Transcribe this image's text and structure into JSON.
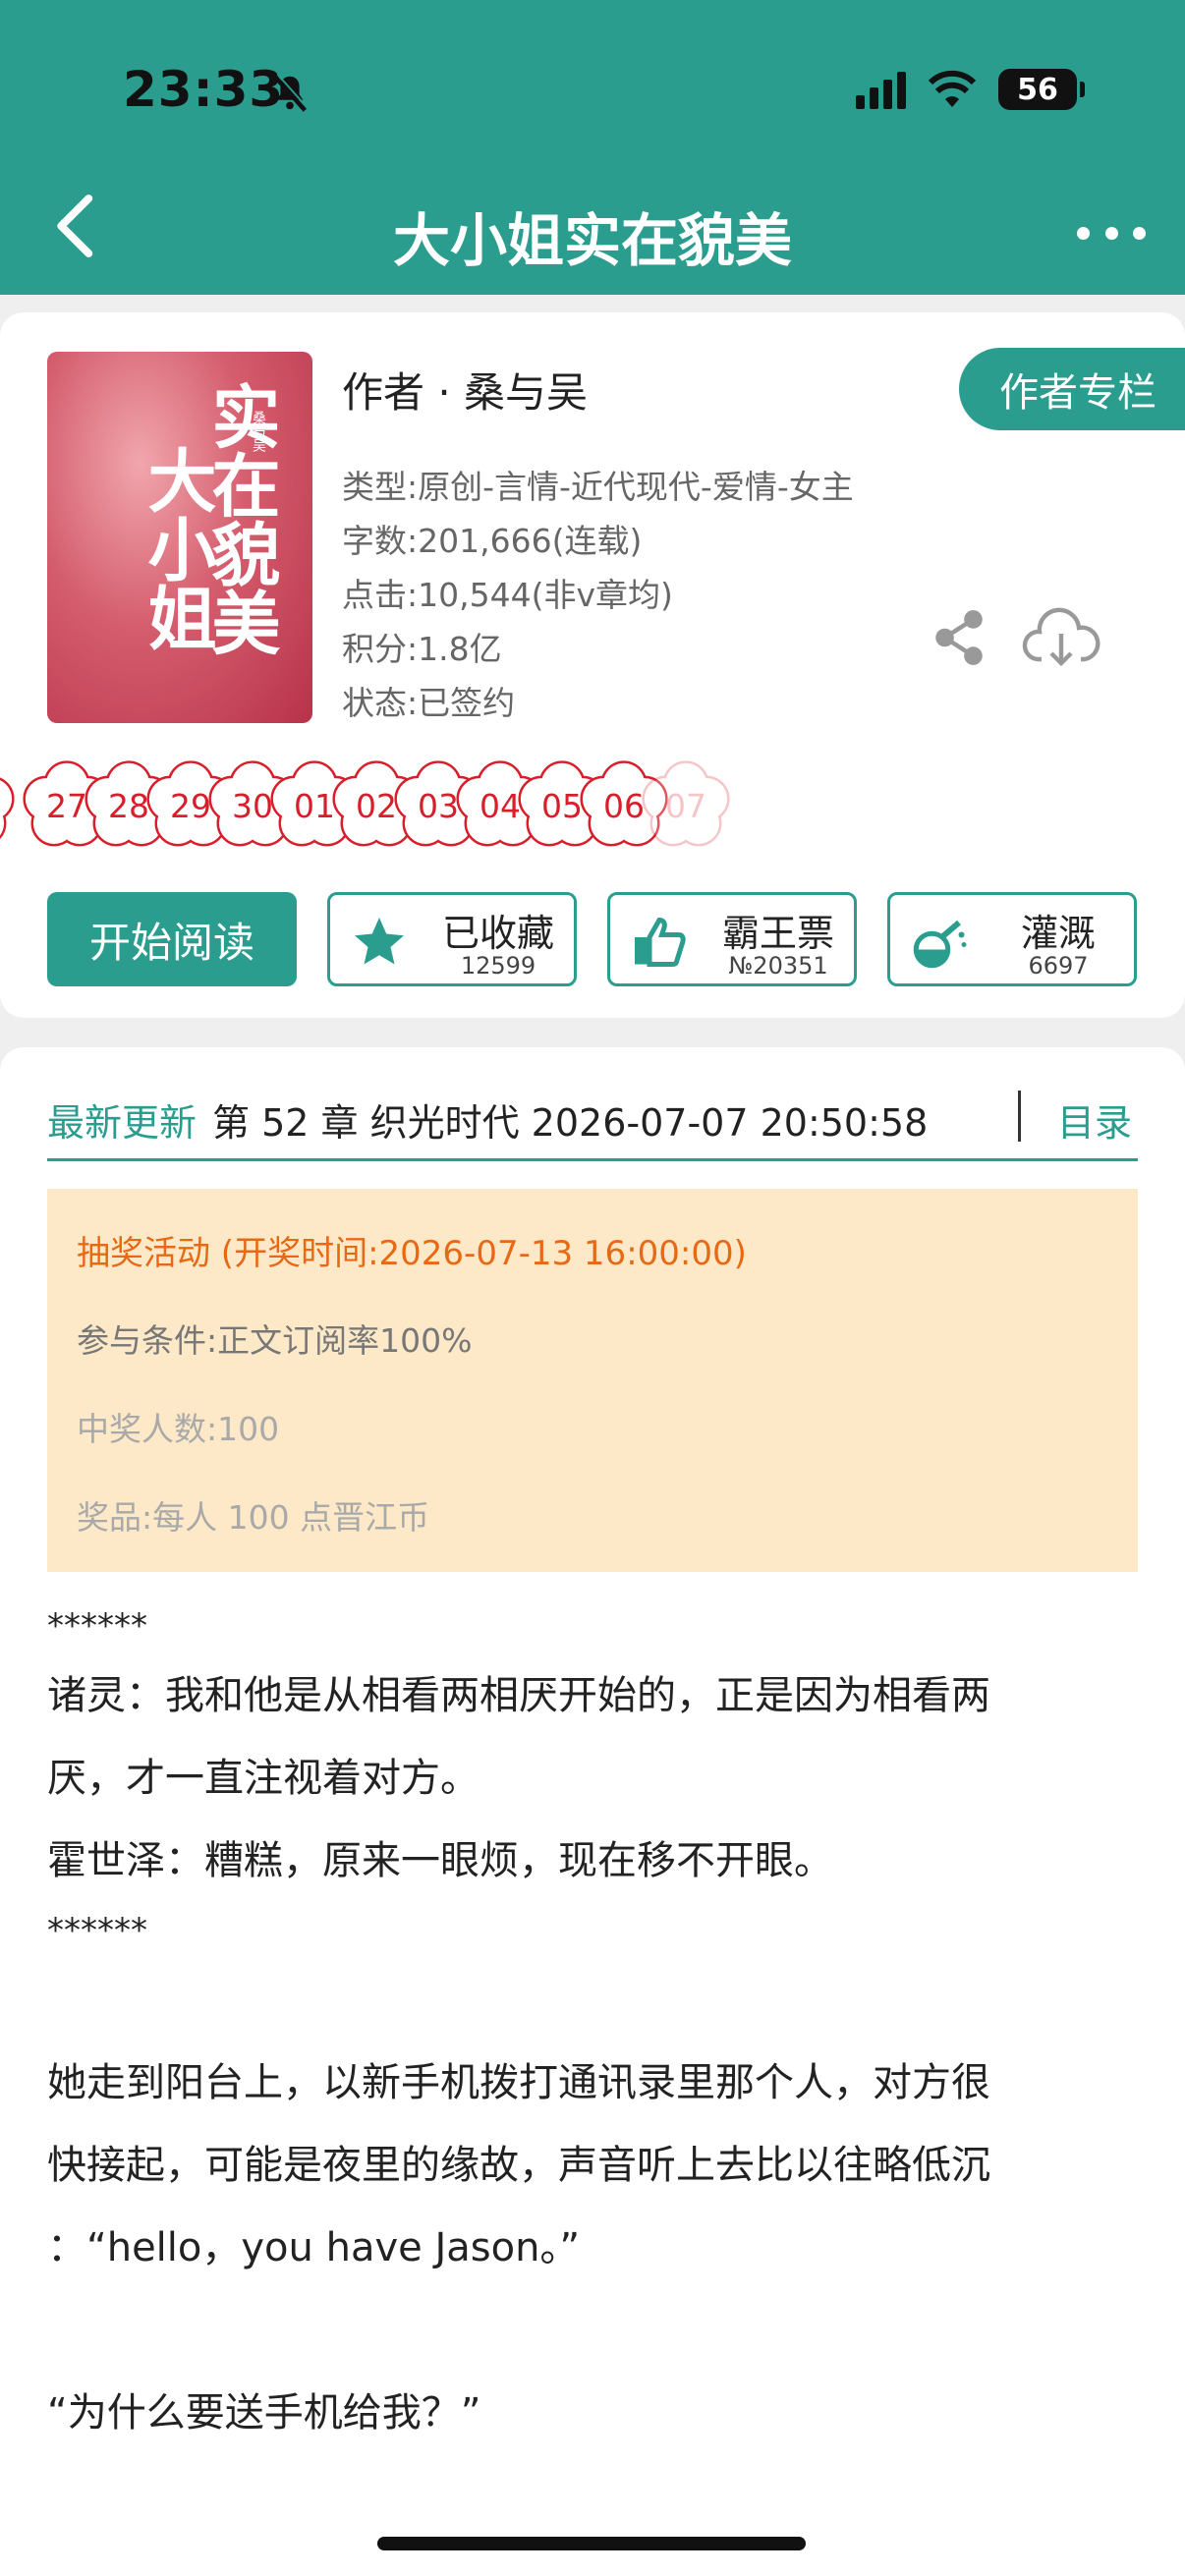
{
  "status_bar": {
    "time": "23:33",
    "battery": "56"
  },
  "nav": {
    "title": "大小姐实在貌美"
  },
  "book": {
    "cover_title_right": "实在貌美",
    "cover_title_left": "大小姐",
    "cover_author": "桑与吴",
    "author": "作者 · 桑与吴",
    "author_button": "作者专栏",
    "type": "类型:原创-言情-近代现代-爱情-女主",
    "word_count": "字数:201,666(连载)",
    "clicks": "点击:10,544(非v章均)",
    "points": "积分:1.8亿",
    "status": "状态:已签约"
  },
  "calendar_days": [
    "27",
    "28",
    "29",
    "30",
    "01",
    "02",
    "03",
    "04",
    "05",
    "06",
    "07"
  ],
  "actions": {
    "read": "开始阅读",
    "collect_label": "已收藏",
    "collect_count": "12599",
    "vote_label": "霸王票",
    "vote_count": "№20351",
    "water_label": "灌溉",
    "water_count": "6697"
  },
  "update": {
    "label": "最新更新",
    "chapter": "第 52 章 织光时代 2026-07-07 20:50:58",
    "toc": "目录"
  },
  "lottery": {
    "title": "抽奖活动 (开奖时间:2026-07-13 16:00:00)",
    "condition": "参与条件:正文订阅率100%",
    "winners": "中奖人数:100",
    "prize": "奖品:每人 100 点晋江币"
  },
  "content": {
    "stars1": "******",
    "line1": "诸灵：我和他是从相看两相厌开始的，正是因为相看两",
    "line2": "厌，才一直注视着对方。",
    "line3": "霍世泽：糟糕，原来一眼烦，现在移不开眼。",
    "stars2": "******",
    "line4": "她走到阳台上，以新手机拨打通讯录里那个人，对方很",
    "line5": "快接起，可能是夜里的缘故，声音听上去比以往略低沉",
    "line6": "：“hello，you have Jason。”",
    "line7": "“为什么要送手机给我？”"
  },
  "colors": {
    "accent": "#2a9d8f",
    "lottery_bg": "#fde9c8",
    "lottery_title": "#e66a16",
    "flower": "#d81e2a"
  }
}
